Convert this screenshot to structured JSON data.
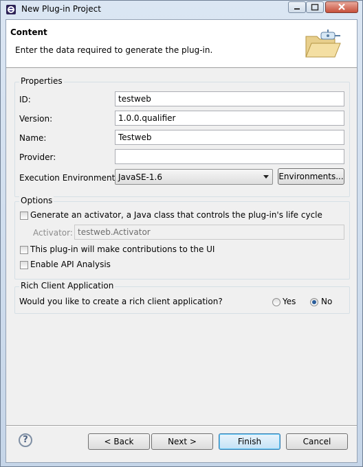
{
  "window": {
    "title": "New Plug-in Project",
    "icon": "eclipse-icon"
  },
  "header": {
    "title": "Content",
    "description": "Enter the data required to generate the plug-in.",
    "icon": "folder-plugin-icon"
  },
  "properties": {
    "group_label": "Properties",
    "id_label": "ID:",
    "id_value": "testweb",
    "version_label": "Version:",
    "version_value": "1.0.0.qualifier",
    "name_label": "Name:",
    "name_value": "Testweb",
    "provider_label": "Provider:",
    "provider_value": "",
    "exec_env_label": "Execution Environment:",
    "exec_env_value": "JavaSE-1.6",
    "environments_button": "Environments..."
  },
  "options": {
    "group_label": "Options",
    "generate_activator_label": "Generate an activator, a Java class that controls the plug-in's life cycle",
    "generate_activator_checked": false,
    "activator_label": "Activator:",
    "activator_value": "testweb.Activator",
    "ui_contrib_label": "This plug-in will make contributions to the UI",
    "ui_contrib_checked": false,
    "api_analysis_label": "Enable API Analysis",
    "api_analysis_checked": false
  },
  "rcp": {
    "group_label": "Rich Client Application",
    "question": "Would you like to create a rich client application?",
    "yes_label": "Yes",
    "no_label": "No",
    "selected": "No"
  },
  "footer": {
    "help": "?",
    "back": "< Back",
    "next": "Next >",
    "finish": "Finish",
    "cancel": "Cancel"
  }
}
